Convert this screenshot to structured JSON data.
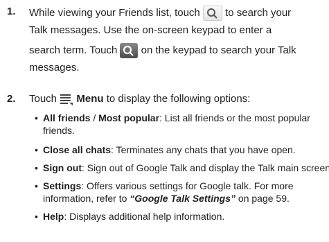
{
  "step1": {
    "number": "1.",
    "l1a": "While viewing your Friends list, touch",
    "l1b": "to search your",
    "l2": "Talk messages. Use the on-screen keypad to enter a",
    "l3": "search term. Touch",
    "l3b": "on the keypad to search your Talk",
    "l4": "messages."
  },
  "step2": {
    "number": "2.",
    "a": "Touch",
    "menu_label": "Menu",
    "b": "to display the following options:"
  },
  "bullets": [
    {
      "bold1": "All friends",
      "sep": " / ",
      "bold2": "Most popular",
      "text": ": List all friends or the most popular",
      "cont": "friends."
    },
    {
      "bold1": "Close all chats",
      "text": ": Terminates any chats that you have open."
    },
    {
      "bold1": "Sign out",
      "text": ": Sign out of Google Talk and display the Talk main screen."
    },
    {
      "bold1": "Settings",
      "text": ": Offers various settings for Google talk. For more",
      "cont1": "information, refer to ",
      "ref": "“Google Talk Settings”",
      "cont2": " on page 59."
    },
    {
      "bold1": "Help",
      "text": ": Displays additional help information."
    }
  ]
}
